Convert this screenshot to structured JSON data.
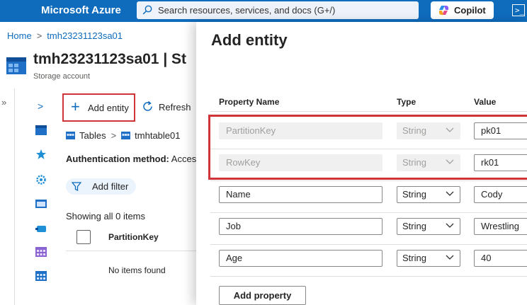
{
  "topbar": {
    "brand": "Microsoft Azure",
    "search_placeholder": "Search resources, services, and docs (G+/)",
    "copilot_label": "Copilot",
    "cloudshell_glyph": ">_"
  },
  "breadcrumb": {
    "home": "Home",
    "resource": "tmh23231123sa01"
  },
  "resource": {
    "title": "tmh23231123sa01 | St",
    "subtitle": "Storage account"
  },
  "toolbar": {
    "add_entity": "Add entity",
    "refresh": "Refresh"
  },
  "table_breadcrumb": {
    "tables": "Tables",
    "table": "tmhtable01"
  },
  "auth": {
    "label": "Authentication method:",
    "value": "Access"
  },
  "filter": {
    "label": "Add filter"
  },
  "grid": {
    "showing": "Showing all 0 items",
    "column": "PartitionKey",
    "empty": "No items found"
  },
  "panel": {
    "title": "Add entity",
    "headers": {
      "name": "Property Name",
      "type": "Type",
      "value": "Value"
    },
    "rows": [
      {
        "name": "PartitionKey",
        "type": "String",
        "value": "pk01",
        "disabled": true
      },
      {
        "name": "RowKey",
        "type": "String",
        "value": "rk01",
        "disabled": true
      },
      {
        "name": "Name",
        "type": "String",
        "value": "Cody",
        "disabled": false
      },
      {
        "name": "Job",
        "type": "String",
        "value": "Wrestling",
        "disabled": false
      },
      {
        "name": "Age",
        "type": "String",
        "value": "40",
        "disabled": false
      }
    ],
    "add_property": "Add property"
  },
  "colors": {
    "azure_blue": "#0f6cbd",
    "highlight_red": "#d13438",
    "disabled_fill": "#f0f0f0"
  }
}
